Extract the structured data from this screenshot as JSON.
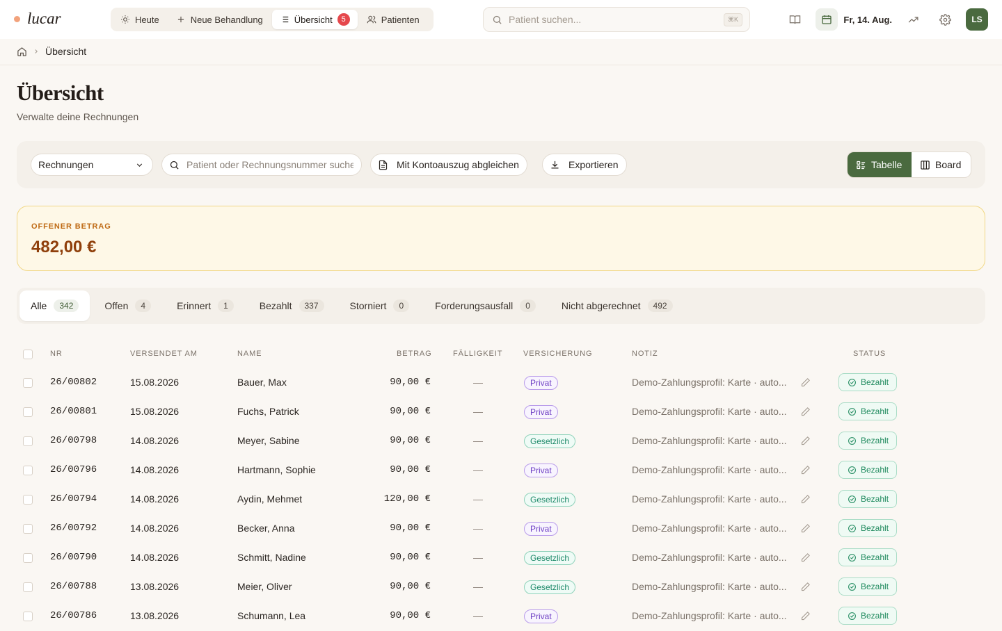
{
  "app": {
    "logo": "lucar",
    "accent": "#4a6a3f"
  },
  "nav": {
    "items": [
      {
        "label": "Heute",
        "icon": "sun-icon"
      },
      {
        "label": "Neue Behandlung",
        "icon": "plus-icon"
      },
      {
        "label": "Übersicht",
        "icon": "list-icon",
        "badge": "5",
        "active": true
      },
      {
        "label": "Patienten",
        "icon": "users-icon"
      }
    ]
  },
  "global_search": {
    "placeholder": "Patient suchen...",
    "shortcut": "⌘K"
  },
  "topbar": {
    "date": "Fr, 14. Aug.",
    "avatar": "LS"
  },
  "breadcrumb": {
    "current": "Übersicht"
  },
  "page": {
    "title": "Übersicht",
    "subtitle": "Verwalte deine Rechnungen"
  },
  "toolbar": {
    "select_value": "Rechnungen",
    "search_placeholder": "Patient oder Rechnungsnummer suchen",
    "reconcile_label": "Mit Kontoauszug abgleichen",
    "export_label": "Exportieren",
    "view_table": "Tabelle",
    "view_board": "Board"
  },
  "open_amount": {
    "label": "OFFENER BETRAG",
    "value": "482,00 €"
  },
  "tabs": [
    {
      "label": "Alle",
      "count": "342",
      "active": true
    },
    {
      "label": "Offen",
      "count": "4"
    },
    {
      "label": "Erinnert",
      "count": "1"
    },
    {
      "label": "Bezahlt",
      "count": "337"
    },
    {
      "label": "Storniert",
      "count": "0"
    },
    {
      "label": "Forderungsausfall",
      "count": "0"
    },
    {
      "label": "Nicht abgerechnet",
      "count": "492"
    }
  ],
  "table": {
    "headers": {
      "nr": "NR",
      "sent": "VERSENDET AM",
      "name": "NAME",
      "amount": "BETRAG",
      "due": "FÄLLIGKEIT",
      "insurance": "VERSICHERUNG",
      "note": "NOTIZ",
      "status": "STATUS"
    },
    "rows": [
      {
        "nr": "26/00802",
        "sent": "15.08.2026",
        "name": "Bauer, Max",
        "amount": "90,00 €",
        "due": "—",
        "insurance": "Privat",
        "note": "Demo-Zahlungsprofil: Karte · auto...",
        "status": "Bezahlt"
      },
      {
        "nr": "26/00801",
        "sent": "15.08.2026",
        "name": "Fuchs, Patrick",
        "amount": "90,00 €",
        "due": "—",
        "insurance": "Privat",
        "note": "Demo-Zahlungsprofil: Karte · auto...",
        "status": "Bezahlt"
      },
      {
        "nr": "26/00798",
        "sent": "14.08.2026",
        "name": "Meyer, Sabine",
        "amount": "90,00 €",
        "due": "—",
        "insurance": "Gesetzlich",
        "note": "Demo-Zahlungsprofil: Karte · auto...",
        "status": "Bezahlt"
      },
      {
        "nr": "26/00796",
        "sent": "14.08.2026",
        "name": "Hartmann, Sophie",
        "amount": "90,00 €",
        "due": "—",
        "insurance": "Privat",
        "note": "Demo-Zahlungsprofil: Karte · auto...",
        "status": "Bezahlt"
      },
      {
        "nr": "26/00794",
        "sent": "14.08.2026",
        "name": "Aydin, Mehmet",
        "amount": "120,00 €",
        "due": "—",
        "insurance": "Gesetzlich",
        "note": "Demo-Zahlungsprofil: Karte · auto...",
        "status": "Bezahlt"
      },
      {
        "nr": "26/00792",
        "sent": "14.08.2026",
        "name": "Becker, Anna",
        "amount": "90,00 €",
        "due": "—",
        "insurance": "Privat",
        "note": "Demo-Zahlungsprofil: Karte · auto...",
        "status": "Bezahlt"
      },
      {
        "nr": "26/00790",
        "sent": "14.08.2026",
        "name": "Schmitt, Nadine",
        "amount": "90,00 €",
        "due": "—",
        "insurance": "Gesetzlich",
        "note": "Demo-Zahlungsprofil: Karte · auto...",
        "status": "Bezahlt"
      },
      {
        "nr": "26/00788",
        "sent": "13.08.2026",
        "name": "Meier, Oliver",
        "amount": "90,00 €",
        "due": "—",
        "insurance": "Gesetzlich",
        "note": "Demo-Zahlungsprofil: Karte · auto...",
        "status": "Bezahlt"
      },
      {
        "nr": "26/00786",
        "sent": "13.08.2026",
        "name": "Schumann, Lea",
        "amount": "90,00 €",
        "due": "—",
        "insurance": "Privat",
        "note": "Demo-Zahlungsprofil: Karte · auto...",
        "status": "Bezahlt"
      }
    ]
  }
}
